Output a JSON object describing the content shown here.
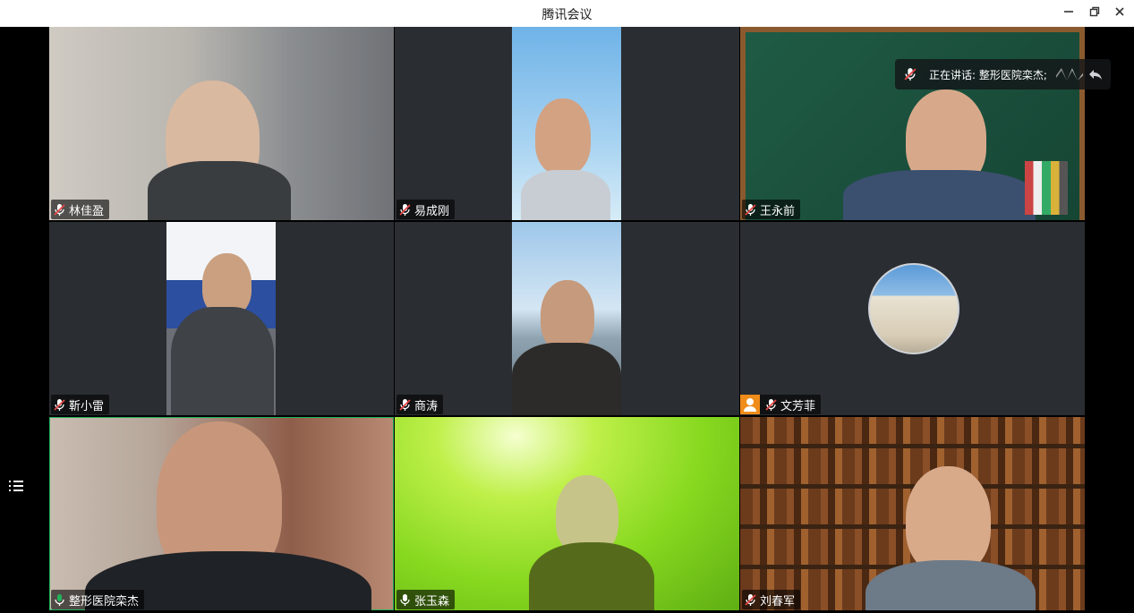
{
  "window": {
    "title": "腾讯会议",
    "minimize_icon": "minimize-icon",
    "restore_icon": "restore-icon",
    "close_icon": "close-icon"
  },
  "speaking_indicator": {
    "text": "正在讲话: 整形医院栾杰;",
    "icon": "mic-muted-icon"
  },
  "side_button": {
    "icon": "list-icon"
  },
  "participants": [
    {
      "name": "林佳盈",
      "mic": "muted"
    },
    {
      "name": "易成刚",
      "mic": "muted"
    },
    {
      "name": "王永前",
      "mic": "muted"
    },
    {
      "name": "靳小雷",
      "mic": "muted"
    },
    {
      "name": "商涛",
      "mic": "muted"
    },
    {
      "name": "文芳菲",
      "mic": "muted",
      "camera": "off"
    },
    {
      "name": "整形医院栾杰",
      "mic": "on"
    },
    {
      "name": "张玉森",
      "mic": "on"
    },
    {
      "name": "刘春军",
      "mic": "muted"
    }
  ],
  "colors": {
    "muted_mic": "#e64545",
    "active_mic": "#1fb45a",
    "active_speaker_border": "#1fb45a",
    "avatar_badge": "#f08c1a"
  }
}
